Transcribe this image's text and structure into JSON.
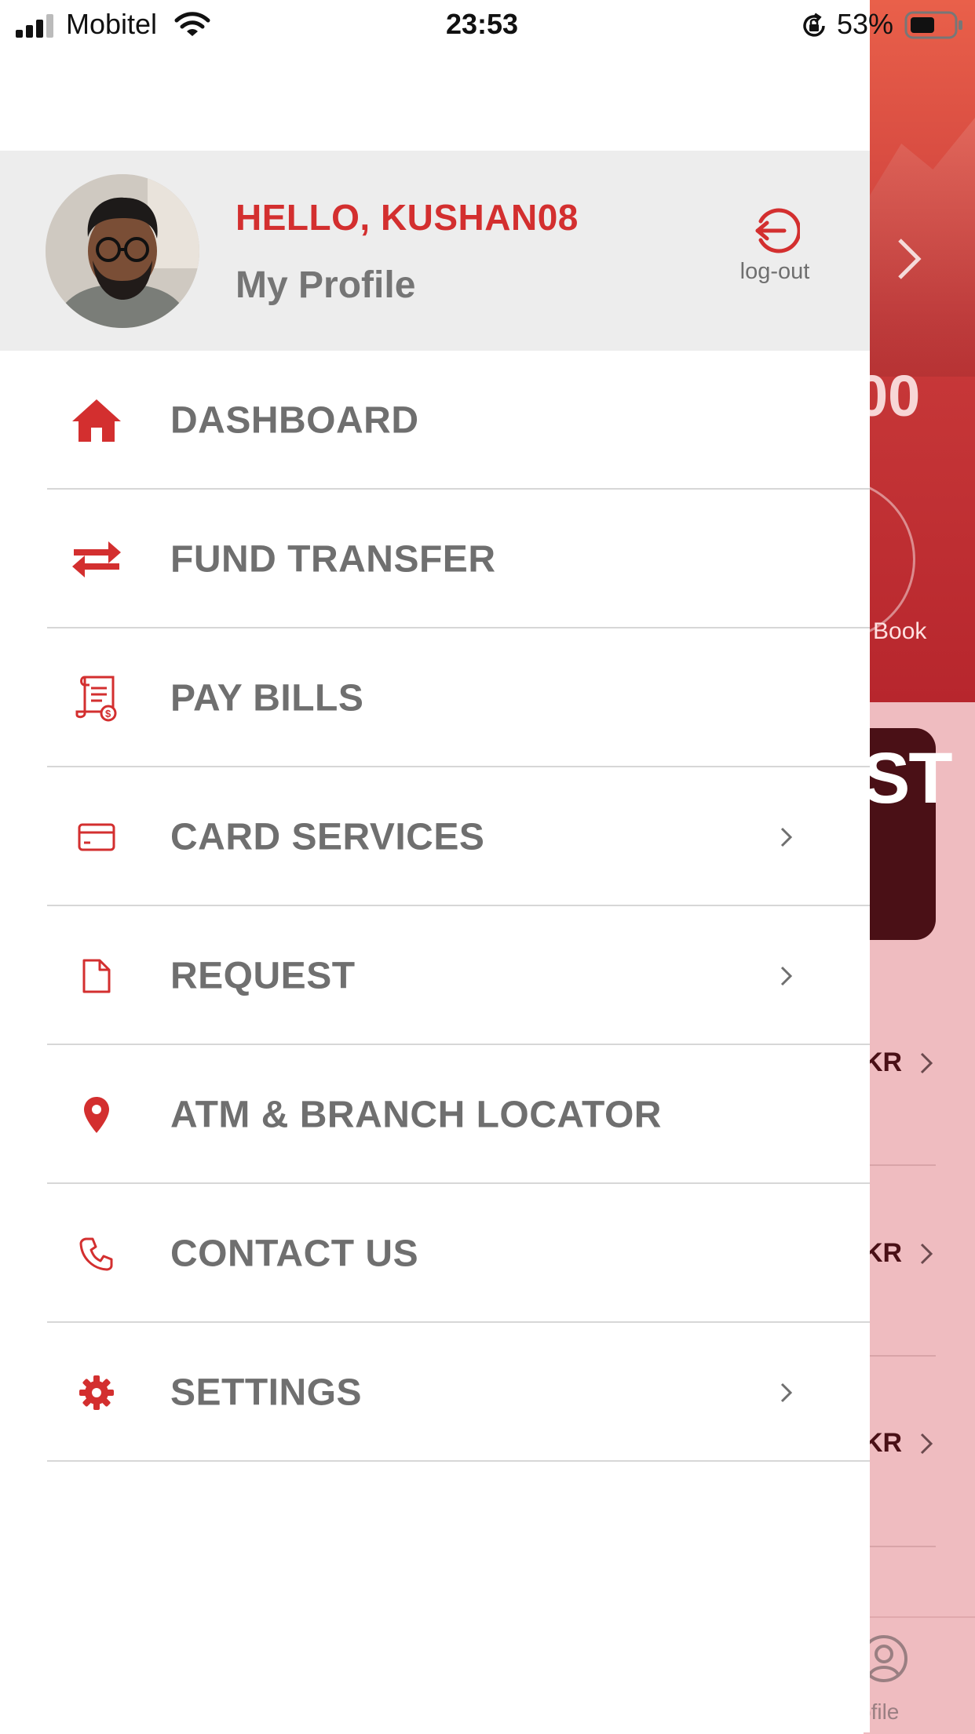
{
  "status_bar": {
    "carrier": "Mobitel",
    "time": "23:53",
    "battery": "53%"
  },
  "profile": {
    "greeting": "HELLO, KUSHAN08",
    "link": "My Profile",
    "logout_label": "log-out"
  },
  "menu": {
    "items": [
      {
        "label": "DASHBOARD",
        "icon": "home-icon",
        "has_submenu": false
      },
      {
        "label": "FUND TRANSFER",
        "icon": "transfer-icon",
        "has_submenu": false
      },
      {
        "label": "PAY BILLS",
        "icon": "bill-icon",
        "has_submenu": false
      },
      {
        "label": "CARD SERVICES",
        "icon": "card-icon",
        "has_submenu": true
      },
      {
        "label": "REQUEST",
        "icon": "document-icon",
        "has_submenu": true
      },
      {
        "label": "ATM & BRANCH LOCATOR",
        "icon": "location-pin-icon",
        "has_submenu": false
      },
      {
        "label": "CONTACT US",
        "icon": "phone-icon",
        "has_submenu": false
      },
      {
        "label": "SETTINGS",
        "icon": "gear-icon",
        "has_submenu": true
      }
    ]
  },
  "background": {
    "amount_fragment": "00",
    "book_fragment": "Book",
    "card_fragment": "ST",
    "rows": [
      "KR",
      "KR",
      "KR"
    ],
    "tab_fragment": "ofile"
  },
  "colors": {
    "accent": "#d32f2f",
    "menu_text": "#6f6f6f",
    "header_bg": "#ededed"
  }
}
